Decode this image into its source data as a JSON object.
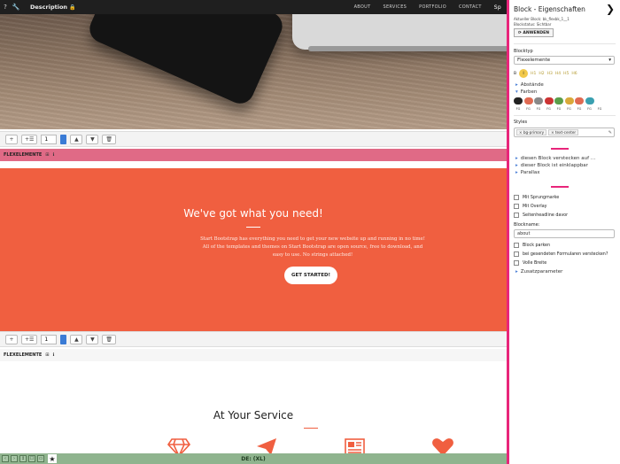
{
  "topbar": {
    "help_icon": "?",
    "tool_icon": "🔧",
    "description_label": "Description",
    "lock_icon": "🔒",
    "nav": [
      "ABOUT",
      "SERVICES",
      "PORTFOLIO",
      "CONTACT",
      "Sp"
    ]
  },
  "toolbar1": {
    "add_label": "+",
    "add_list_label": "+☰",
    "number": "1",
    "up_label": "▲",
    "down_label": "▼",
    "delete_label": "🗑"
  },
  "flexbar1": {
    "label": "FLEXELEMENTE",
    "extra1": "⊞",
    "extra2": "ℹ"
  },
  "hero": {
    "title": "We've got what you need!",
    "body": "Start Bootstrap has everything you need to get your new website up and running in no time! All of the templates and themes on Start Bootstrap are open source, free to download, and easy to use. No strings attached!",
    "cta": "GET STARTED!"
  },
  "toolbar2": {
    "add_label": "+",
    "add_list_label": "+☰",
    "number": "1",
    "up_label": "▲",
    "down_label": "▼",
    "delete_label": "🗑"
  },
  "flexbar2": {
    "label": "FLEXELEMENTE",
    "extra1": "⊞",
    "extra2": "ℹ"
  },
  "service": {
    "title": "At Your Service",
    "icons": [
      "diamond-icon",
      "paper-plane-icon",
      "newspaper-icon",
      "heart-icon"
    ],
    "accent": "#f05f40"
  },
  "statusbar": {
    "buttons": [
      "‹",
      "›",
      "↕",
      "☐",
      "▭"
    ],
    "star": "★",
    "lang": "DE: (XL)"
  },
  "panel": {
    "title": "Block - Eigenschaften",
    "close_icon": "❯",
    "meta_block": "Aktueller Block: bk_flexbk_1__1",
    "meta_state": "Blockstatus: Sichtbar",
    "apply": "⟳ ANWENDEN",
    "blocktype_label": "Blocktyp",
    "blocktype_value": "Flexelemente",
    "heading_buttons": [
      "B",
      "I",
      "H1",
      "H2",
      "H3",
      "H4",
      "H5",
      "H6"
    ],
    "abstaende": "Abstände",
    "farben": "Farben",
    "swatch_colors": [
      "#222222",
      "#e06a52",
      "#888888",
      "#cc3333",
      "#5a9e4a",
      "#d9a93a",
      "#e06a52",
      "#3aa0b0",
      "#ffffff",
      "#ffffff"
    ],
    "swatch_bg_labels": [
      "BG",
      "BG",
      "BG",
      "BG",
      "BG",
      "BG",
      "BG",
      "BG",
      "BG",
      "BG"
    ],
    "fg_labels": [
      "FG",
      "FG",
      "FG",
      "FG",
      "FG",
      "FG",
      "FG",
      "FG",
      "FG",
      "FG"
    ],
    "styles_label": "Styles",
    "styles_chips": [
      "× bg-primary",
      "× text-center"
    ],
    "edit_icon": "✎",
    "toggles": [
      "diesen Block verstecken auf …",
      "dieser Block ist einklappbar",
      "Parallax"
    ],
    "checks1": [
      "Mit Sprungmarke",
      "Mit Overlay",
      "Seitenheadline davor"
    ],
    "blockname_label": "Blockname:",
    "blockname_value": "about",
    "checks2": [
      "Block parken",
      "bei gesendeten Formularen verstecken?",
      "Volle Breite"
    ],
    "zusatz": "Zusatzparameter"
  }
}
